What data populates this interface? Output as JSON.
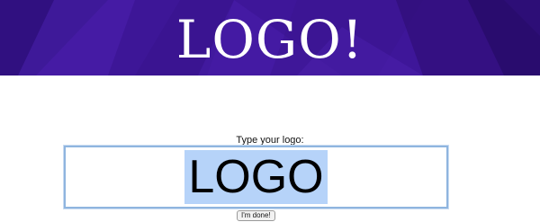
{
  "banner": {
    "logo_text": "LOGO!",
    "background_color": "#3d1596"
  },
  "form": {
    "prompt_label": "Type your logo:",
    "input_value": "LOGO",
    "selection_color": "#b6d3f9",
    "focus_border_color": "#8fb5df",
    "submit_label": "I'm done!"
  }
}
